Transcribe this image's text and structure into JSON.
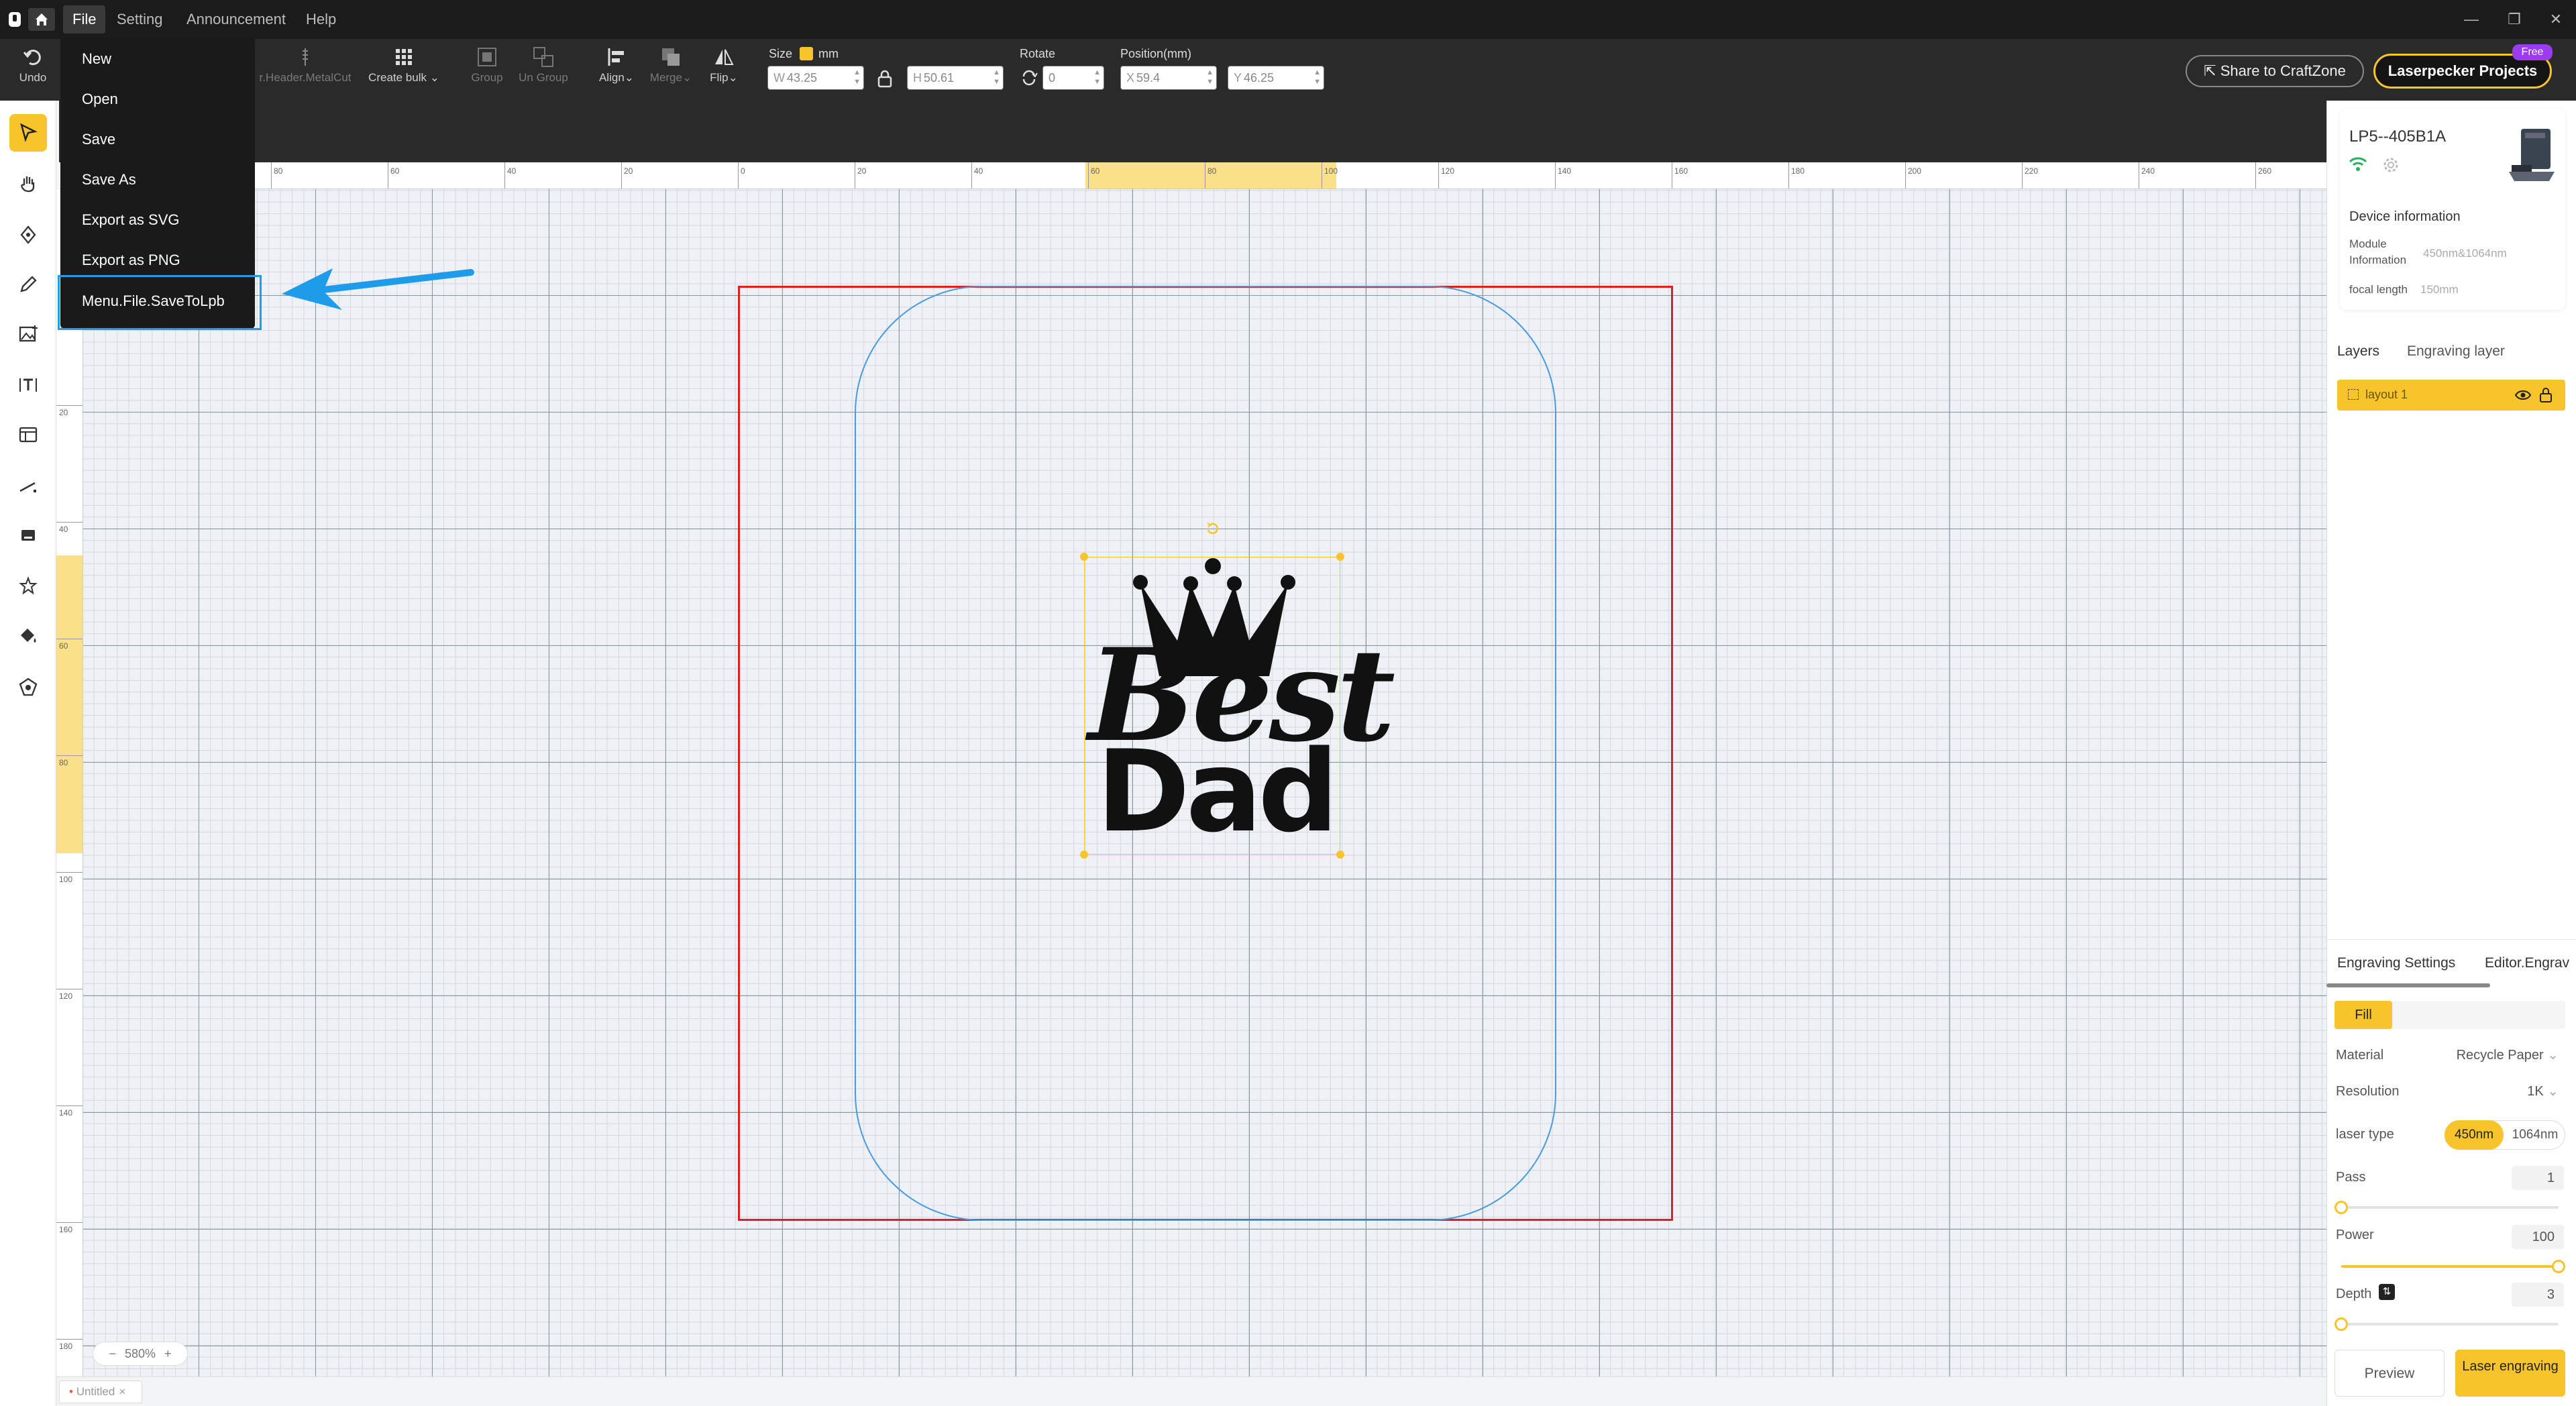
{
  "menubar": {
    "items": [
      {
        "label": "File"
      },
      {
        "label": "Setting"
      },
      {
        "label": "Announcement"
      },
      {
        "label": "Help"
      }
    ]
  },
  "toolbar": {
    "undo": "Undo",
    "metalcut": "r.Header.MetalCut",
    "create_bulk": "Create bulk",
    "group": "Group",
    "ungroup": "Un Group",
    "align": "Align",
    "merge": "Merge",
    "flip": "Flip",
    "size_label": "Size",
    "size_unit": "mm",
    "rotate_label": "Rotate",
    "position_label": "Position(mm)",
    "w_prefix": "W",
    "w_value": "43.25",
    "h_prefix": "H",
    "h_value": "50.61",
    "rot_value": "0",
    "x_prefix": "X",
    "x_value": "59.4",
    "y_prefix": "Y",
    "y_value": "46.25",
    "share": "Share to CraftZone",
    "projects": "Laserpecker Projects",
    "free": "Free"
  },
  "file_menu": {
    "items": [
      {
        "label": "New"
      },
      {
        "label": "Open"
      },
      {
        "label": "Save"
      },
      {
        "label": "Save As"
      },
      {
        "label": "Export as SVG"
      },
      {
        "label": "Export as PNG"
      },
      {
        "label": "Menu.File.SaveToLpb"
      }
    ]
  },
  "rulers": {
    "h_ticks": [
      "80",
      "60",
      "40",
      "20",
      "0",
      "20",
      "40",
      "60",
      "80",
      "100",
      "120",
      "140",
      "160",
      "180",
      "200",
      "220",
      "240",
      "260"
    ],
    "v_ticks": [
      "20",
      "40",
      "60",
      "80",
      "100",
      "120",
      "140",
      "160",
      "180"
    ]
  },
  "artwork": {
    "line1": "Best",
    "line2": "Dad"
  },
  "device": {
    "name": "LP5--405B1A",
    "info_title": "Device information",
    "module_label": "Module Information",
    "module_value": "450nm&1064nm",
    "focal_label": "focal length",
    "focal_value": "150mm"
  },
  "layers": {
    "tab_layers": "Layers",
    "tab_engraving": "Engraving layer",
    "item": "layout 1"
  },
  "settings": {
    "tab_engraving": "Engraving Settings",
    "tab_editor": "Editor.Engrav",
    "mode": "Fill",
    "material_label": "Material",
    "material_value": "Recycle Paper",
    "resolution_label": "Resolution",
    "resolution_value": "1K",
    "laser_type_label": "laser type",
    "laser_opt1": "450nm",
    "laser_opt2": "1064nm",
    "pass_label": "Pass",
    "pass_value": "1",
    "pass_fraction": 0.0,
    "power_label": "Power",
    "power_value": "100",
    "power_fraction": 1.0,
    "depth_label": "Depth",
    "depth_value": "3",
    "depth_fraction": 0.0,
    "preview": "Preview",
    "laser_engraving": "Laser engraving"
  },
  "zoom": {
    "minus": "−",
    "level": "580%",
    "plus": "+"
  },
  "doc_tab": {
    "name": "Untitled",
    "close": "×"
  },
  "colors": {
    "accent": "#f7c52b",
    "highlight": "#1e9be9",
    "work_area": "#e02020",
    "outline": "#4a9ae0"
  }
}
